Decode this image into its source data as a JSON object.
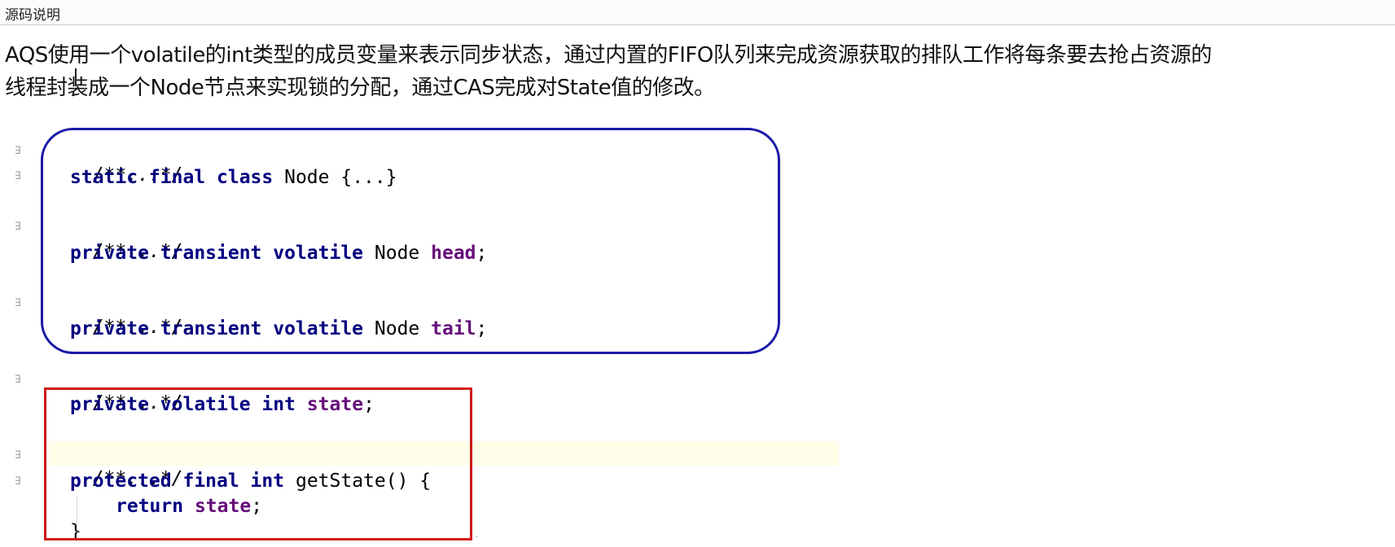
{
  "header": {
    "title": "源码说明"
  },
  "description": {
    "line1": "AQS使用一个volatile的int类型的成员变量来表示同步状态，通过内置的FIFO队列来完成资源获取的排队工作将每条要去抢占资源的",
    "line2": "线程封装成一个Node节点来实现锁的分配，通过CAS完成对State值的修改。"
  },
  "code": {
    "lines": [
      {
        "comment": "/**...*/"
      },
      {
        "kw": "static final class",
        "type": "Node",
        "rest": "{...}"
      },
      {
        "comment": "/**...*/"
      },
      {
        "kw": "private transient volatile",
        "type": "Node",
        "field": "head",
        "end": ";"
      },
      {
        "comment": "/**...*/"
      },
      {
        "kw": "private transient volatile",
        "type": "Node",
        "field": "tail",
        "end": ";"
      },
      {
        "comment": "/**...*/"
      },
      {
        "kw": "private volatile int",
        "field": "state",
        "end": ";"
      },
      {
        "comment": "/**...*/"
      },
      {
        "kw": "protected final int",
        "method": "getState() {"
      },
      {
        "kw": "return",
        "field": "state",
        "end": ";"
      },
      {
        "brace": "}"
      }
    ]
  },
  "colors": {
    "blue_box": "#1a1aa8",
    "red_box": "#d11a1a",
    "keyword": "#000080",
    "field": "#660e7a"
  }
}
